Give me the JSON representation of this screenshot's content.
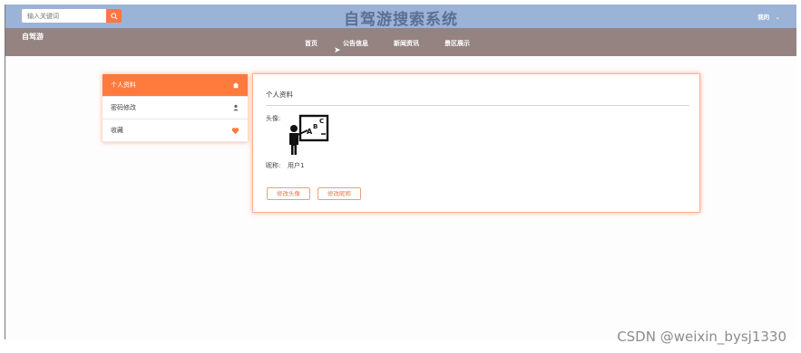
{
  "header": {
    "search_placeholder": "输入关键词",
    "title": "自驾游搜索系统",
    "user_menu": "我的"
  },
  "nav": {
    "brand": "自驾游",
    "items": [
      "首页",
      "公告信息",
      "新闻资讯",
      "景区展示"
    ]
  },
  "sidebar": {
    "items": [
      {
        "label": "个人资料",
        "icon": "house-icon"
      },
      {
        "label": "密码修改",
        "icon": "person-icon"
      },
      {
        "label": "收藏",
        "icon": "heart-icon"
      }
    ]
  },
  "profile": {
    "title": "个人资料",
    "avatar_label": "头像:",
    "nickname_label": "昵称:",
    "nickname_value": "用户1",
    "change_avatar_button": "修改头像",
    "change_nickname_button": "修改昵称"
  },
  "watermark": "CSDN @weixin_bysj1330",
  "colors": {
    "accent": "#ff7a3d",
    "topbar": "#9bb3d6",
    "navbar": "#958381"
  }
}
